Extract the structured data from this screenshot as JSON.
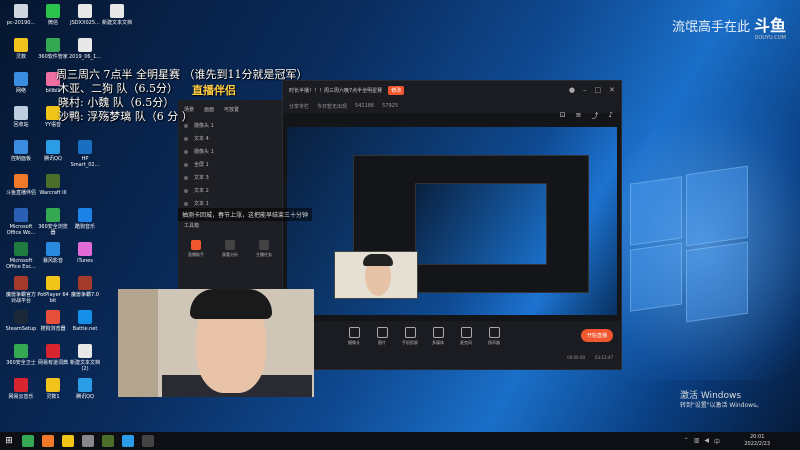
{
  "watermark": {
    "slogan": "流氓高手在此",
    "logo": "斗鱼",
    "domain": "DOUYU.COM"
  },
  "overlay": {
    "line1": "周三周六 7点半 全明星赛 （谁先到11分就是冠军）",
    "line2": "木亚、二狗        队（6.5分）",
    "line3": "晓村: 小魏        队（6.5分）",
    "line4": "沙鸭: 浮殇梦璃  队（6 分 ）"
  },
  "subtitle": "抽测卡回城，春节上涨，这把能早结束三十分钟",
  "desktop_icons": [
    {
      "label": "pc-20190...",
      "color": "#cfd6e0"
    },
    {
      "label": "微信",
      "color": "#2bc24d"
    },
    {
      "label": "JSDXX025...",
      "color": "#e8e8e8"
    },
    {
      "label": "新建文本文档",
      "color": "#e8e8e8"
    },
    {
      "label": "灵数",
      "color": "#f2c21c"
    },
    {
      "label": "360软件管家",
      "color": "#35a853"
    },
    {
      "label": "2019_06_1...",
      "color": "#e8e8e8"
    },
    {
      "label": "网络",
      "color": "#3a8de0"
    },
    {
      "label": "bilibili",
      "color": "#f06fa1"
    },
    {
      "label": "回收站",
      "color": "#bfcde0"
    },
    {
      "label": "YY语音",
      "color": "#f0c419"
    },
    {
      "label": "控制面板",
      "color": "#3a8de0"
    },
    {
      "label": "腾讯QQ",
      "color": "#2a9de6"
    },
    {
      "label": "HP Smart_02...",
      "color": "#1a70c0"
    },
    {
      "label": "斗鱼直播伴侣",
      "color": "#f07a2a"
    },
    {
      "label": "Warcraft III",
      "color": "#4d6d2b"
    },
    {
      "label": "Microsoft Office Wo...",
      "color": "#2b5fb3"
    },
    {
      "label": "360安全浏览器",
      "color": "#35a853"
    },
    {
      "label": "酷狗音乐",
      "color": "#1e83e6"
    },
    {
      "label": "Microsoft Office Exc...",
      "color": "#1f7a3f"
    },
    {
      "label": "暴风影音",
      "color": "#2a8ae0"
    },
    {
      "label": "iTunes",
      "color": "#e26bd8"
    },
    {
      "label": "魔兽争霸官方对战平台",
      "color": "#a33a2a"
    },
    {
      "label": "PotPlayer 64 bit",
      "color": "#f0c419"
    },
    {
      "label": "魔兽争霸7.0",
      "color": "#a33a2a"
    },
    {
      "label": "SteamSetup",
      "color": "#1b2838"
    },
    {
      "label": "搜狗浏览器",
      "color": "#e84f3a"
    },
    {
      "label": "Battle.net",
      "color": "#148ee6"
    },
    {
      "label": "360安全卫士",
      "color": "#35a853"
    },
    {
      "label": "网易有道词典",
      "color": "#d8242f"
    },
    {
      "label": "新建文本文档(2)",
      "color": "#e8e8e8"
    },
    {
      "label": "网易云音乐",
      "color": "#d8242f"
    },
    {
      "label": "灵数1",
      "color": "#f2c21c"
    },
    {
      "label": "腾讯QQ",
      "color": "#2a9de6"
    }
  ],
  "app": {
    "logo": "直播伴侣",
    "left_tabs": [
      "场景",
      "画面",
      "可放置"
    ],
    "scenes": [
      "摄像头 1",
      "文本 4",
      "摄像头 1",
      "全屏 1",
      "文本 3",
      "文本 2",
      "文本 1"
    ],
    "toolbox_label": "工具箱",
    "tools": [
      "直播助手",
      "观看分析",
      "主播任务"
    ],
    "title": "时长半播！！！周三周六晚7点半全明星赛",
    "title_tag": "修改",
    "info": [
      "分享专栏",
      "今日暂无出现",
      "541186",
      "57925"
    ],
    "bottom_tools": [
      "摄像头",
      "图片",
      "手机投屏",
      "多媒体",
      "麦克风",
      "扬声器"
    ],
    "start_button": "开始直播",
    "timer_left": "00:00:00",
    "timer_right": "03:13:47"
  },
  "activate": {
    "line1": "激活 Windows",
    "line2": "转到\"设置\"以激活 Windows。"
  },
  "taskbar": {
    "time": "20:01",
    "date": "2022/2/23"
  }
}
